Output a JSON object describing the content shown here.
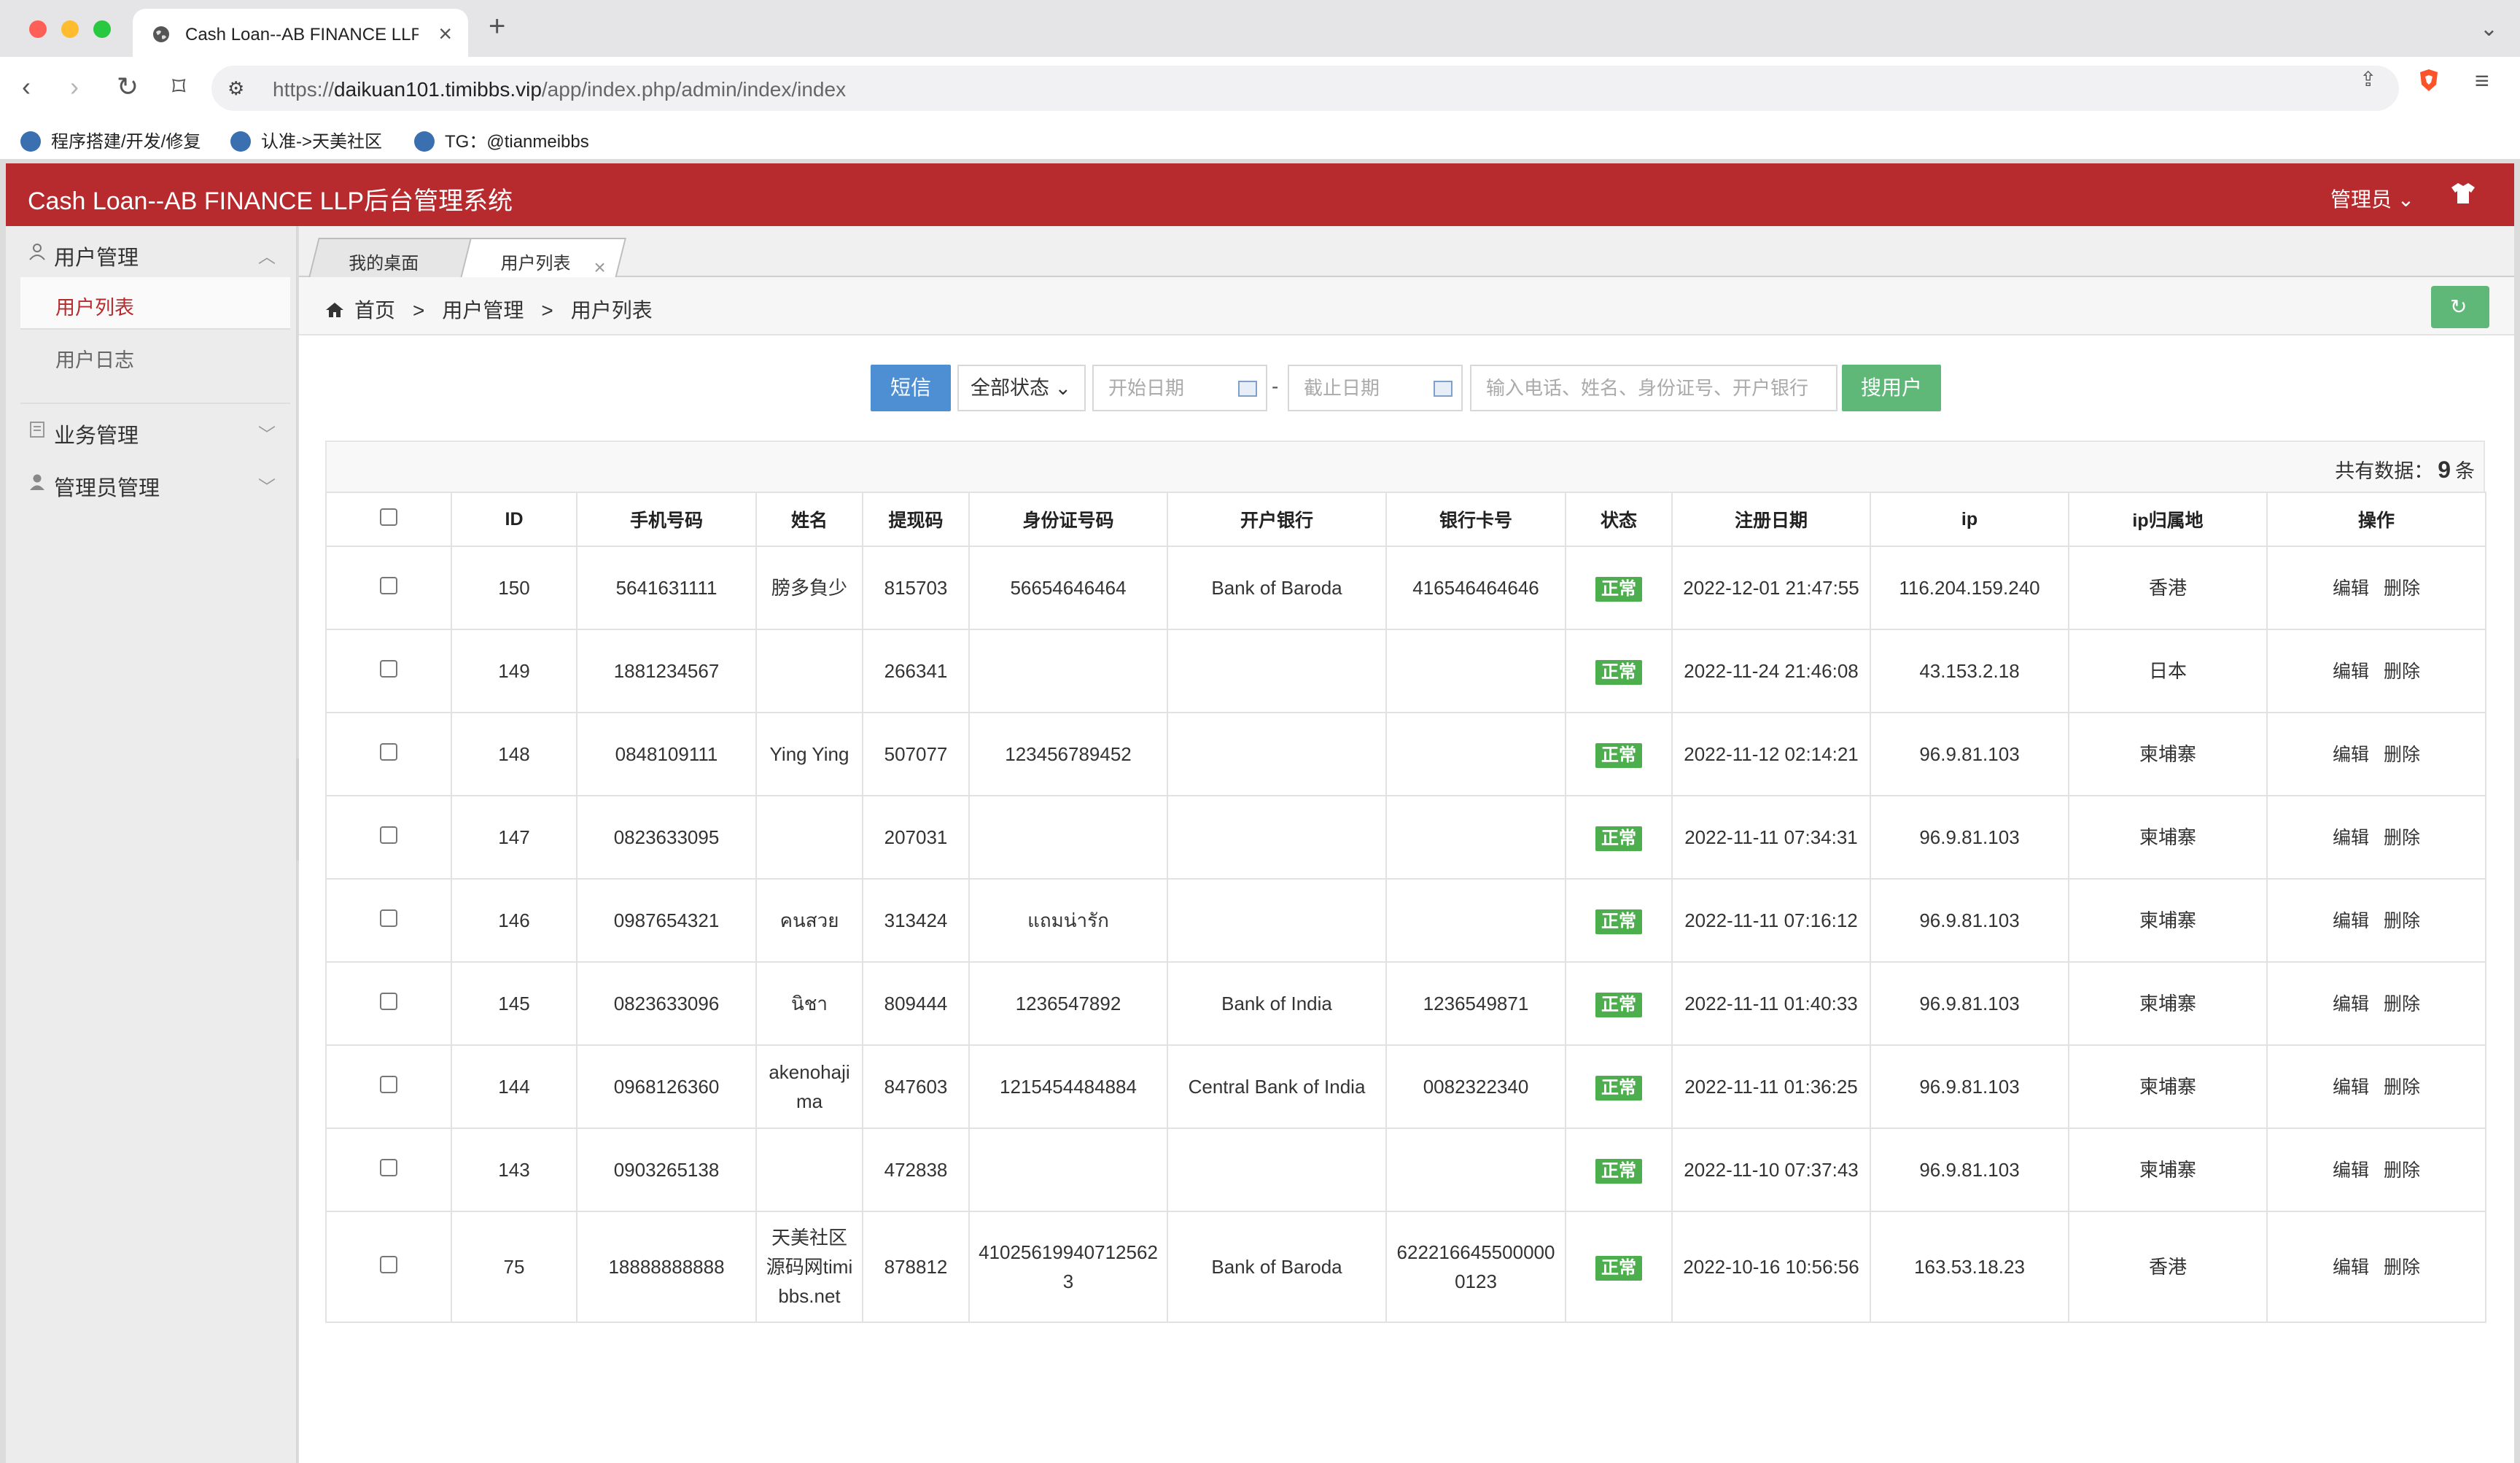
{
  "browser": {
    "tab_title": "Cash Loan--AB FINANCE LLP",
    "url_prefix": "https://",
    "url_host": "daikuan101.timibbs.vip",
    "url_path": "/app/index.php/admin/index/index",
    "bookmarks": [
      "程序搭建/开发/修复",
      "认准->天美社区",
      "TG：@tianmeibbs"
    ]
  },
  "app": {
    "title": "Cash Loan--AB FINANCE LLP后台管理系统",
    "admin_label": "管理员"
  },
  "sidebar": {
    "groups": [
      {
        "label": "用户管理",
        "expanded": true,
        "items": [
          {
            "label": "用户列表",
            "active": true
          },
          {
            "label": "用户日志",
            "active": false
          }
        ]
      },
      {
        "label": "业务管理",
        "expanded": false
      },
      {
        "label": "管理员管理",
        "expanded": false
      }
    ]
  },
  "page_tabs": [
    {
      "label": "我的桌面"
    },
    {
      "label": "用户列表",
      "closable": true
    }
  ],
  "breadcrumb": [
    "首页",
    "用户管理",
    "用户列表"
  ],
  "search": {
    "sms_label": "短信",
    "status_value": "全部状态",
    "start_date_placeholder": "开始日期",
    "end_date_placeholder": "截止日期",
    "date_separator": "-",
    "keyword_placeholder": "输入电话、姓名、身份证号、开户银行",
    "search_label": "搜用户"
  },
  "summary": {
    "prefix": "共有数据：",
    "count": "9",
    "suffix": "条"
  },
  "table": {
    "columns": [
      "ID",
      "手机号码",
      "姓名",
      "提现码",
      "身份证号码",
      "开户银行",
      "银行卡号",
      "状态",
      "注册日期",
      "ip",
      "ip归属地",
      "操作"
    ],
    "edit_label": "编辑",
    "delete_label": "删除",
    "rows": [
      {
        "id": "150",
        "phone": "5641631111",
        "name": "膀多負少",
        "code": "815703",
        "idcard": "56654646464",
        "bank": "Bank of Baroda",
        "card": "416546464646",
        "status": "正常",
        "date": "2022-12-01 21:47:55",
        "ip": "116.204.159.240",
        "region": "香港"
      },
      {
        "id": "149",
        "phone": "1881234567",
        "name": "",
        "code": "266341",
        "idcard": "",
        "bank": "",
        "card": "",
        "status": "正常",
        "date": "2022-11-24 21:46:08",
        "ip": "43.153.2.18",
        "region": "日本"
      },
      {
        "id": "148",
        "phone": "0848109111",
        "name": "Ying Ying",
        "code": "507077",
        "idcard": "123456789452",
        "bank": "",
        "card": "",
        "status": "正常",
        "date": "2022-11-12 02:14:21",
        "ip": "96.9.81.103",
        "region": "柬埔寨"
      },
      {
        "id": "147",
        "phone": "0823633095",
        "name": "",
        "code": "207031",
        "idcard": "",
        "bank": "",
        "card": "",
        "status": "正常",
        "date": "2022-11-11 07:34:31",
        "ip": "96.9.81.103",
        "region": "柬埔寨"
      },
      {
        "id": "146",
        "phone": "0987654321",
        "name": "คนสวย",
        "code": "313424",
        "idcard": "แถมน่ารัก",
        "bank": "",
        "card": "",
        "status": "正常",
        "date": "2022-11-11 07:16:12",
        "ip": "96.9.81.103",
        "region": "柬埔寨"
      },
      {
        "id": "145",
        "phone": "0823633096",
        "name": "นิชา",
        "code": "809444",
        "idcard": "1236547892",
        "bank": "Bank of India",
        "card": "1236549871",
        "status": "正常",
        "date": "2022-11-11 01:40:33",
        "ip": "96.9.81.103",
        "region": "柬埔寨"
      },
      {
        "id": "144",
        "phone": "0968126360",
        "name": "akenohajima",
        "code": "847603",
        "idcard": "1215454484884",
        "bank": "Central Bank of India",
        "card": "0082322340",
        "status": "正常",
        "date": "2022-11-11 01:36:25",
        "ip": "96.9.81.103",
        "region": "柬埔寨"
      },
      {
        "id": "143",
        "phone": "0903265138",
        "name": "",
        "code": "472838",
        "idcard": "",
        "bank": "",
        "card": "",
        "status": "正常",
        "date": "2022-11-10 07:37:43",
        "ip": "96.9.81.103",
        "region": "柬埔寨"
      },
      {
        "id": "75",
        "phone": "18888888888",
        "name": "天美社区源码网timibbs.net",
        "code": "878812",
        "idcard": "410256199407125623",
        "bank": "Bank of Baroda",
        "card": "6222166455000000123",
        "status": "正常",
        "date": "2022-10-16 10:56:56",
        "ip": "163.53.18.23",
        "region": "香港"
      }
    ]
  },
  "colors": {
    "brand_red": "#b72a2d",
    "green": "#5fb878",
    "blue": "#4e8fd4",
    "badge_green": "#4cae4c"
  }
}
